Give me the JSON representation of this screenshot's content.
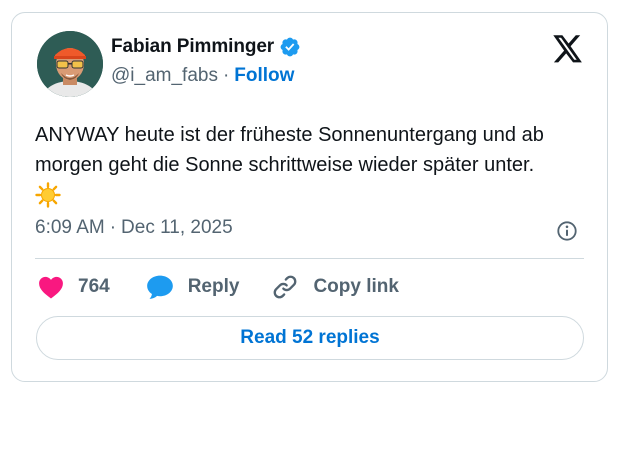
{
  "author": {
    "display_name": "Fabian Pimminger",
    "handle": "@i_am_fabs",
    "separator": "·",
    "follow_label": "Follow",
    "verified": true,
    "avatar_icon": "avatar-photo"
  },
  "tweet": {
    "text": "ANYWAY heute ist der früheste Sonnenuntergang und ab morgen geht die Sonne schrittweise wieder später unter.",
    "emoji_icon": "sun-emoji",
    "time": "6:09 AM",
    "date_separator": "·",
    "date": "Dec 11, 2025"
  },
  "actions": {
    "like_count": "764",
    "reply_label": "Reply",
    "copy_link_label": "Copy link"
  },
  "read_replies_label": "Read 52 replies",
  "colors": {
    "accent_blue": "#0074d4",
    "like_pink": "#f91880",
    "reply_blue": "#1d9bf0",
    "verified_blue": "#1d9bf0",
    "muted_text": "#536471",
    "border": "#cfd9de"
  },
  "icons": [
    "verified-badge-icon",
    "x-logo-icon",
    "info-icon",
    "heart-icon",
    "reply-bubble-icon",
    "link-icon",
    "sun-emoji-icon"
  ]
}
